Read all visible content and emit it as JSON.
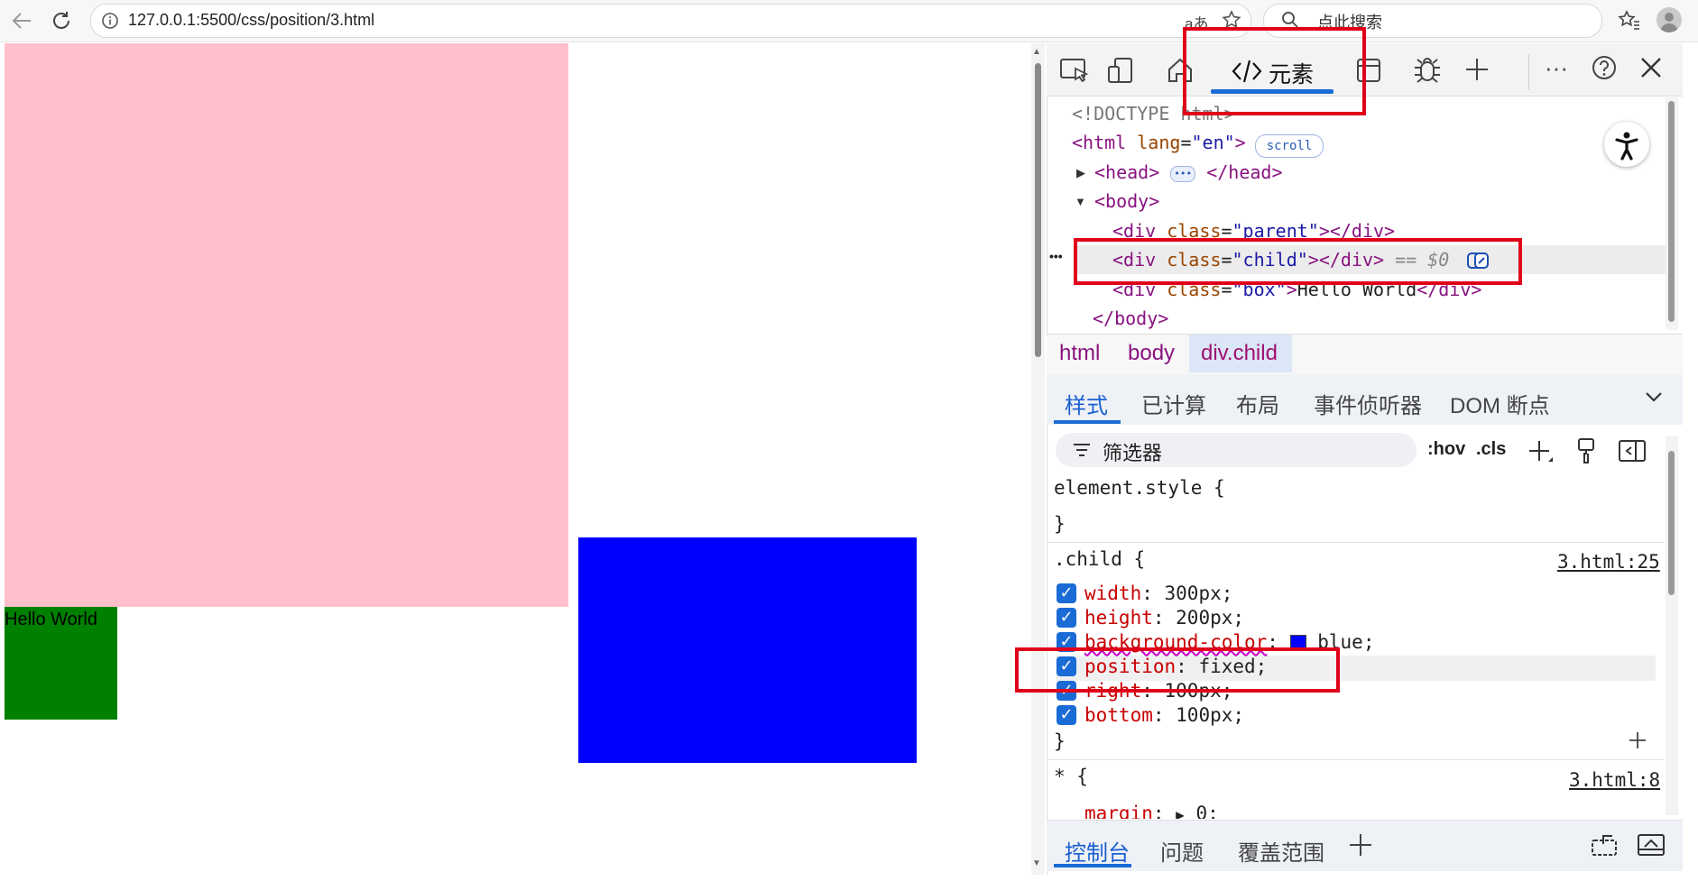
{
  "browser": {
    "url": "127.0.0.1:5500/css/position/3.html",
    "search_placeholder": "点此搜索",
    "translate_icon": "aあ"
  },
  "page": {
    "text": "Hello World",
    "colors": {
      "parent": "#ffc0cb",
      "box": "#008000",
      "child": "#0000ff"
    }
  },
  "devtools": {
    "tabs": {
      "elements": "元素"
    },
    "dom": {
      "doctype": "<!DOCTYPE html>",
      "html_open": "<html",
      "html_attr": "lang",
      "html_val": "\"en\"",
      "html_close": ">",
      "scroll_badge": "scroll",
      "head_open": "<head>",
      "head_ellipsis": "•••",
      "head_close": "</head>",
      "body_open": "<body>",
      "div_open": "<div",
      "class_attr": "class",
      "parent_val": "\"parent\"",
      "child_val": "\"child\"",
      "box_val": "\"box\"",
      "div_tail": "></div>",
      "gt": ">",
      "box_text": "Hello World",
      "div_close": "</div>",
      "eq_dollar0": "== $0",
      "body_close": "</body>",
      "row_dots": "•••"
    },
    "breadcrumb": [
      "html",
      "body",
      "div.child"
    ],
    "subtabs": [
      "样式",
      "已计算",
      "布局",
      "事件侦听器",
      "DOM 断点"
    ],
    "filter": {
      "placeholder": "筛选器",
      "hov": ":hov",
      "cls": ".cls"
    },
    "styles": {
      "element_style": "element.style {",
      "close_brace": "}",
      "child_selector": ".child {",
      "child_source": "3.html:25",
      "props": [
        {
          "name": "width",
          "value": "300px;"
        },
        {
          "name": "height",
          "value": "200px;"
        },
        {
          "name": "background-color",
          "value": "blue;"
        },
        {
          "name": "position",
          "value": "fixed;"
        },
        {
          "name": "right",
          "value": "100px;"
        },
        {
          "name": "bottom",
          "value": "100px;"
        }
      ],
      "star_selector": "* {",
      "star_source": "3.html:8",
      "margin_name": "margin",
      "margin_value": "0;"
    },
    "bottom_tabs": [
      "控制台",
      "问题",
      "覆盖范围"
    ]
  },
  "icons": [
    "back-arrow-icon",
    "refresh-icon",
    "info-icon",
    "star-icon",
    "search-icon",
    "favorites-icon",
    "avatar",
    "inspect-icon",
    "device-icon",
    "home-icon",
    "sources-icon",
    "bug-icon",
    "plus-icon",
    "more-icon",
    "help-icon",
    "close-icon",
    "accessibility-icon",
    "chevron-down-icon",
    "filter-icon",
    "paint-icon",
    "sidebar-toggle-icon",
    "copilot-icon"
  ]
}
